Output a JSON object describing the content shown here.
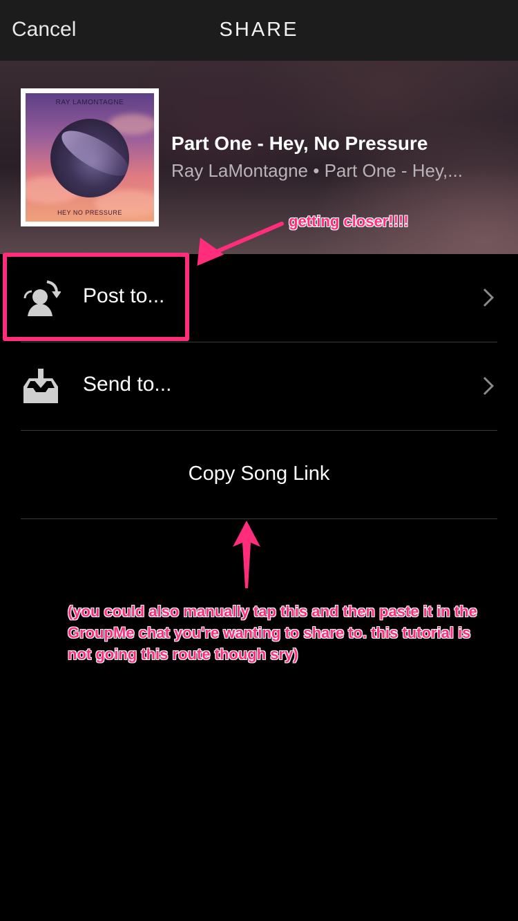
{
  "navbar": {
    "cancel_label": "Cancel",
    "title": "SHARE"
  },
  "track": {
    "title": "Part One - Hey, No Pressure",
    "subtitle": "Ray LaMontagne • Part One - Hey,...",
    "album_art": {
      "artist_text": "RAY LAMONTAGNE",
      "title_text": "HEY NO PRESSURE"
    }
  },
  "actions": {
    "post_label": "Post to...",
    "send_label": "Send to...",
    "copy_label": "Copy Song Link"
  },
  "annotations": {
    "closer": "getting closer!!!!",
    "note": "(you could also manually tap this and then paste it in the GroupMe chat you're wanting to share to. this tutorial is not going this route though sry)"
  },
  "icons": {
    "post": "post-to-icon",
    "send": "send-to-icon",
    "chevron": "chevron-right-icon"
  },
  "colors": {
    "annotation": "#ff2d7c",
    "background": "#000000",
    "navbar": "#1c1c1c"
  }
}
